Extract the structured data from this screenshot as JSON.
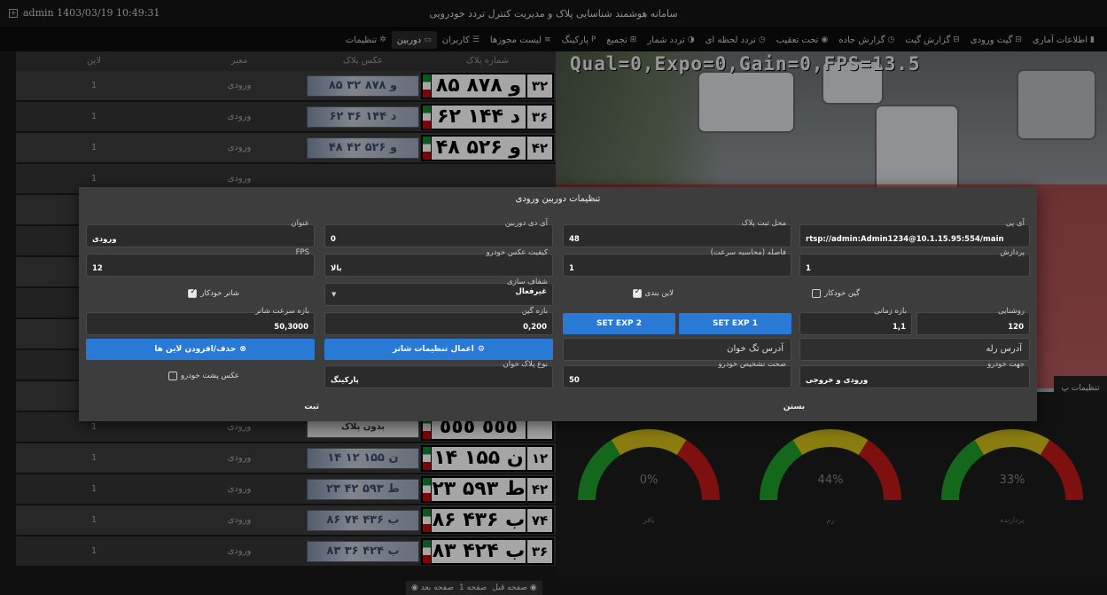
{
  "titlebar": {
    "user": "admin 1403/03/19 10:49:31",
    "title": "سامانه هوشمند شناسایی پلاک و مدیریت کنترل تردد خودرویی"
  },
  "menu": [
    {
      "label": "اطلاعات آماری",
      "icon": "chart-icon",
      "glyph": "▮",
      "active": false
    },
    {
      "label": "گیت ورودی",
      "icon": "gate-icon",
      "glyph": "⊟",
      "active": false
    },
    {
      "label": "گزارش گیت",
      "icon": "report-icon",
      "glyph": "⊟",
      "active": false
    },
    {
      "label": "گزارش جاده",
      "icon": "road-icon",
      "glyph": "◷",
      "active": false
    },
    {
      "label": "تحت تعقیب",
      "icon": "target-icon",
      "glyph": "◉",
      "active": false
    },
    {
      "label": "تردد لحظه ای",
      "icon": "clock-icon",
      "glyph": "◷",
      "active": false
    },
    {
      "label": "تردد شمار",
      "icon": "counter-icon",
      "glyph": "◑",
      "active": false
    },
    {
      "label": "تجمیع",
      "icon": "merge-icon",
      "glyph": "⊞",
      "active": false
    },
    {
      "label": "پارکینگ",
      "icon": "parking-icon",
      "glyph": "P",
      "active": false
    },
    {
      "label": "لیست مجوزها",
      "icon": "list-icon",
      "glyph": "≡",
      "active": false
    },
    {
      "label": "کاربران",
      "icon": "users-icon",
      "glyph": "☰",
      "active": false
    },
    {
      "label": "دوربین",
      "icon": "camera-icon",
      "glyph": "▭",
      "active": true
    },
    {
      "label": "تنظیمات",
      "icon": "gear-icon",
      "glyph": "✲",
      "active": false
    }
  ],
  "table": {
    "headers": [
      "لاین",
      "معبر",
      "عکس پلاک",
      "شماره پلاک"
    ],
    "rows": [
      {
        "lane": "1",
        "passage": "ورودی",
        "plate_img": "۸۵ و ۸۷۸ ۳۲",
        "plate": "۸۵ و ۸۷۸",
        "region": "۳۲"
      },
      {
        "lane": "1",
        "passage": "ورودی",
        "plate_img": "۶۲ د ۱۴۴ ۳۶",
        "plate": "۶۲ د ۱۴۴",
        "region": "۳۶"
      },
      {
        "lane": "1",
        "passage": "ورودی",
        "plate_img": "۴۸ و ۵۲۶ ۴۲",
        "plate": "۴۸ و ۵۲۶",
        "region": "۴۲"
      },
      {
        "lane": "1",
        "passage": "ورودی",
        "plate_img": "",
        "plate": "",
        "region": ""
      },
      {
        "lane": "1",
        "passage": "",
        "plate_img": "",
        "plate": "",
        "region": ""
      },
      {
        "lane": "1",
        "passage": "",
        "plate_img": "",
        "plate": "",
        "region": ""
      },
      {
        "lane": "1",
        "passage": "",
        "plate_img": "",
        "plate": "",
        "region": ""
      },
      {
        "lane": "1",
        "passage": "",
        "plate_img": "",
        "plate": "",
        "region": ""
      },
      {
        "lane": "1",
        "passage": "",
        "plate_img": "",
        "plate": "",
        "region": ""
      },
      {
        "lane": "1",
        "passage": "",
        "plate_img": "",
        "plate": "",
        "region": ""
      },
      {
        "lane": "1",
        "passage": "",
        "plate_img": "",
        "plate": "",
        "region": ""
      },
      {
        "lane": "1",
        "passage": "ورودی",
        "plate_img": "بدون پلاک",
        "plate": "٥٥٥ ٥٥٥",
        "region": ""
      },
      {
        "lane": "1",
        "passage": "ورودی",
        "plate_img": "۱۴ ن ۱۵۵ ۱۲",
        "plate": "۱۴ ن ۱۵۵",
        "region": "۱۲"
      },
      {
        "lane": "1",
        "passage": "ورودی",
        "plate_img": "۲۳ ط ۵۹۳ ۴۲",
        "plate": "۲۳ ط ۵۹۳",
        "region": "۴۲"
      },
      {
        "lane": "1",
        "passage": "ورودی",
        "plate_img": "۸۶ ب ۴۳۶ ۷۴",
        "plate": "۸۶ ب ۴۳۶",
        "region": "۷۴"
      },
      {
        "lane": "1",
        "passage": "ورودی",
        "plate_img": "۸۳ ب ۴۲۴ ۳۶",
        "plate": "۸۳ ب ۴۲۴",
        "region": "۳۶"
      }
    ]
  },
  "pager": {
    "prev": "صفحه قبل",
    "page": "صفحه 1",
    "next": "صفحه بعد"
  },
  "camera": {
    "overlay": "Qual=0,Expo=0,Gain=0,FPS=13.5",
    "settings_tab": "تنظیمات پ"
  },
  "gauges": [
    {
      "value": "0%",
      "label": "باقر",
      "fraction": 0.0
    },
    {
      "value": "44%",
      "label": "رم",
      "fraction": 0.44
    },
    {
      "value": "33%",
      "label": "پردازنده",
      "fraction": 0.33
    }
  ],
  "colors": {
    "accent": "#2979d6",
    "gauge_green": "#1fa02a",
    "gauge_yellow": "#d6c21a",
    "gauge_red": "#c21a1a"
  },
  "modal": {
    "title": "تنظیمات دوربین ورودی",
    "fields": {
      "ip": {
        "label": "آی پی",
        "value": "rtsp://admin:Admin1234@10.1.15.95:554/main"
      },
      "plate_location": {
        "label": "محل ثبت پلاک",
        "value": "48"
      },
      "camera_id": {
        "label": "آی دی دوربین",
        "value": "0"
      },
      "title": {
        "label": "عنوان",
        "value": "ورودی"
      },
      "processing": {
        "label": "پردازش",
        "value": "1"
      },
      "distance": {
        "label": "فاصله (محاسبه سرعت)",
        "value": "1"
      },
      "image_quality": {
        "label": "کیفیت عکس خودرو",
        "value": "بالا"
      },
      "fps": {
        "label": "FPS",
        "value": "12"
      },
      "sharpening": {
        "label": "شفاف سازی",
        "value": "غیرفعال"
      },
      "brightness": {
        "label": "روشنایی",
        "value": "120"
      },
      "time_range": {
        "label": "بازه زمانی",
        "value": "1,1"
      },
      "gain_range": {
        "label": "بازه گین",
        "value": "0,200"
      },
      "shutter_speed": {
        "label": "بازه سرعت شاتر",
        "value": "50,3000"
      },
      "vehicle_direction": {
        "label": "جهت خودرو",
        "value": "ورودی و خروجی"
      },
      "detection_accuracy": {
        "label": "صحت تشخیص خودرو",
        "value": "50"
      },
      "plate_reader_type": {
        "label": "نوع پلاک خوان",
        "value": "پارکینگ"
      }
    },
    "checks": {
      "auto_gain": {
        "label": "گین خودکار",
        "checked": false
      },
      "lane_split": {
        "label": "لاین بندی",
        "checked": true
      },
      "auto_shutter": {
        "label": "شاتر خودکار",
        "checked": true
      },
      "rear_image": {
        "label": "عکس پشت خودرو",
        "checked": false
      }
    },
    "buttons": {
      "set_exp1": "SET EXP 1",
      "set_exp2": "SET EXP 2",
      "apply_shutter": "اعمال تنظیمات شاتر",
      "lanes": "حذف/افزودن لاین ها",
      "close": "بستن",
      "submit": "ثبت"
    },
    "placeholders": {
      "relay": "آدرس رله",
      "tag_reader": "آدرس تگ خوان"
    }
  }
}
